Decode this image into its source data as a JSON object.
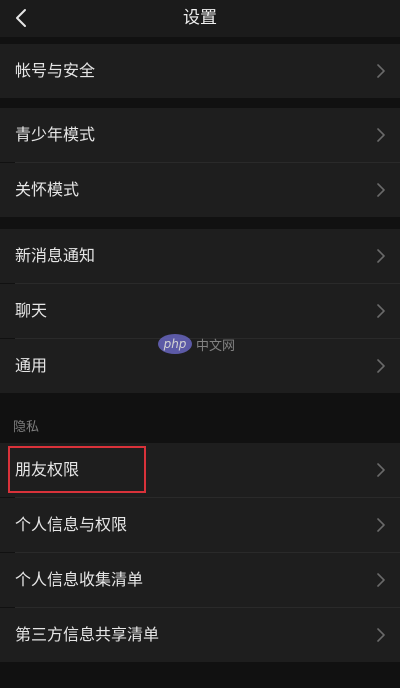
{
  "header": {
    "title": "设置",
    "back_icon": "chevron-left-icon"
  },
  "groups": [
    {
      "items": [
        {
          "label": "帐号与安全",
          "icon": "chevron-right-icon"
        }
      ]
    },
    {
      "items": [
        {
          "label": "青少年模式",
          "icon": "chevron-right-icon"
        },
        {
          "label": "关怀模式",
          "icon": "chevron-right-icon"
        }
      ]
    },
    {
      "items": [
        {
          "label": "新消息通知",
          "icon": "chevron-right-icon"
        },
        {
          "label": "聊天",
          "icon": "chevron-right-icon"
        },
        {
          "label": "通用",
          "icon": "chevron-right-icon"
        }
      ]
    }
  ],
  "privacy": {
    "section_title": "隐私",
    "items": [
      {
        "label": "朋友权限",
        "icon": "chevron-right-icon",
        "highlighted": true
      },
      {
        "label": "个人信息与权限",
        "icon": "chevron-right-icon"
      },
      {
        "label": "个人信息收集清单",
        "icon": "chevron-right-icon"
      },
      {
        "label": "第三方信息共享清单",
        "icon": "chevron-right-icon"
      }
    ]
  },
  "watermark": {
    "logo_text": "php",
    "text": "中文网"
  },
  "colors": {
    "background": "#111111",
    "row_background": "#1e1e1e",
    "highlight_border": "#d9323a",
    "watermark_logo": "#6c69c9"
  }
}
